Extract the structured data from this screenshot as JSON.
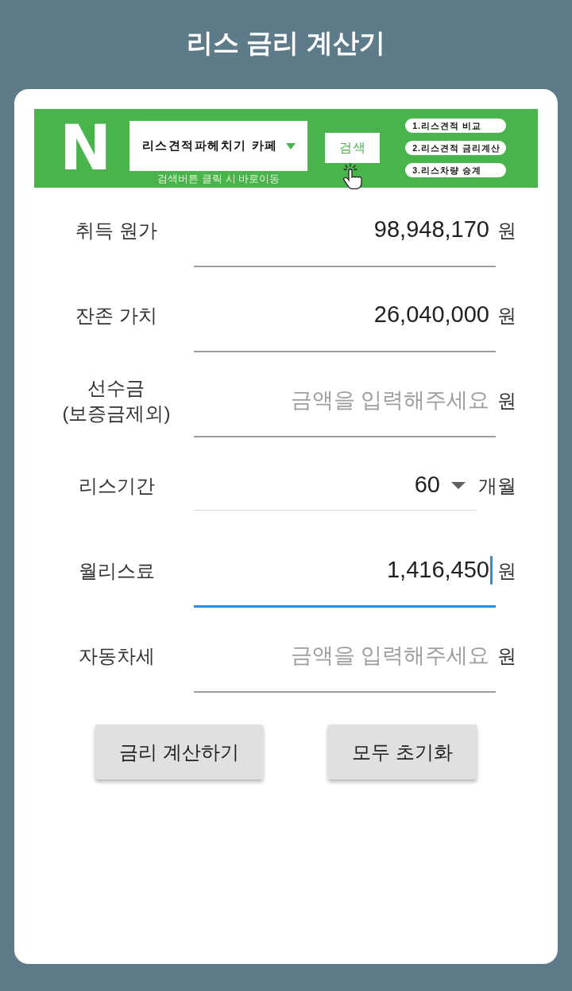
{
  "title": "리스 금리 계산기",
  "banner": {
    "logo": "N",
    "dropdown": "리스견적파헤치기 카페",
    "search_button": "검색",
    "caption": "검색버튼 클릭 시 바로이동",
    "links": [
      "1.리스견적 비교",
      "2.리스견적 금리계산",
      "3.리스차량 승계"
    ]
  },
  "fields": [
    {
      "kind": "text",
      "label": "취득 원가",
      "value": "98,948,170",
      "unit": "원",
      "focused": false
    },
    {
      "kind": "text",
      "label": "잔존 가치",
      "value": "26,040,000",
      "unit": "원",
      "focused": false
    },
    {
      "kind": "text",
      "label": "선수금\n(보증금제외)",
      "placeholder": "금액을 입력해주세요",
      "unit": "원",
      "focused": false
    },
    {
      "kind": "select",
      "label": "리스기간",
      "value": "60",
      "unit": "개월",
      "focused": false
    },
    {
      "kind": "text",
      "label": "월리스료",
      "value": "1,416,450",
      "unit": "원",
      "focused": true
    },
    {
      "kind": "text",
      "label": "자동차세",
      "placeholder": "금액을 입력해주세요",
      "unit": "원",
      "focused": false
    }
  ],
  "buttons": [
    "금리 계산하기",
    "모두 초기화"
  ]
}
